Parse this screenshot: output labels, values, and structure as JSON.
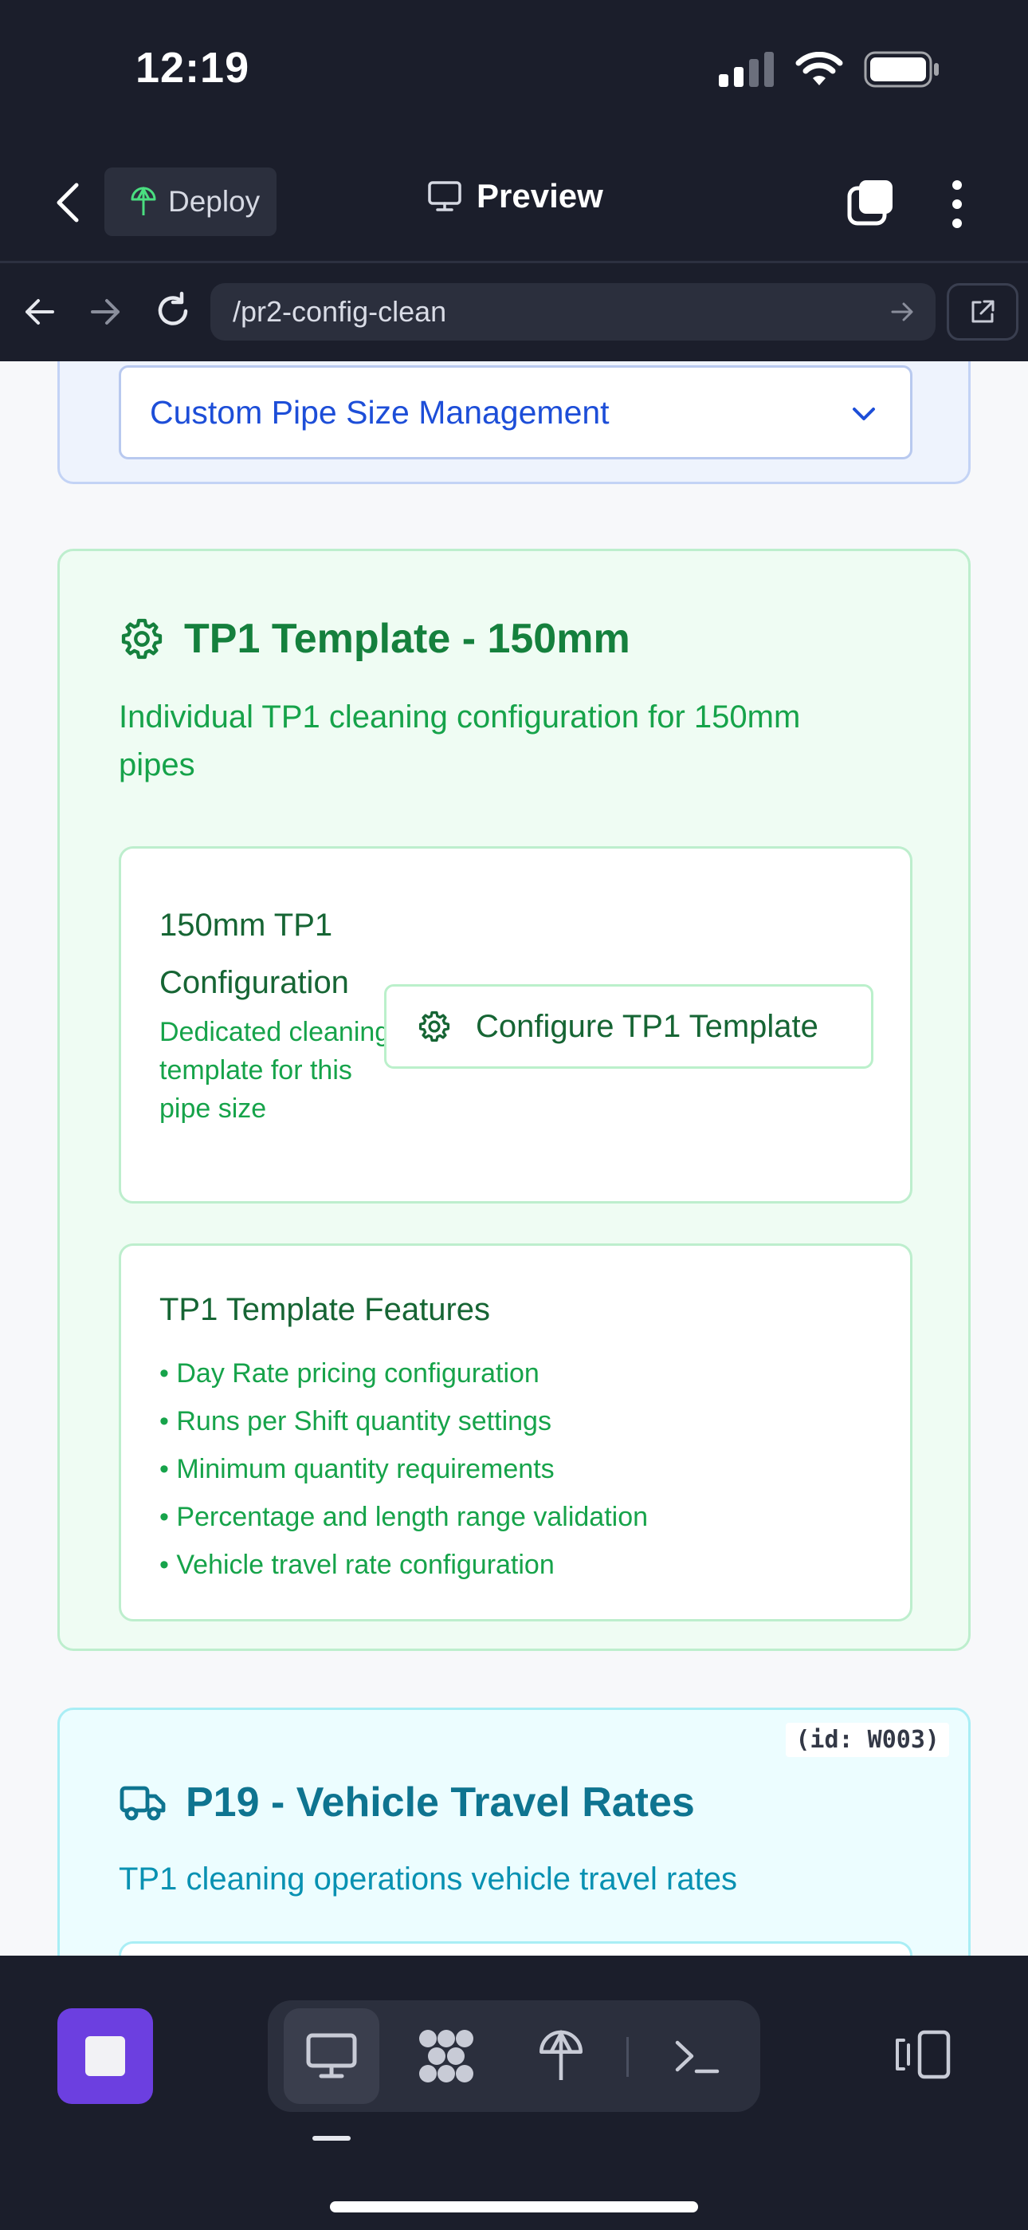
{
  "status_bar": {
    "time": "12:19"
  },
  "header": {
    "deploy_label": "Deploy",
    "preview_label": "Preview"
  },
  "url_bar": {
    "url": "/pr2-config-clean"
  },
  "pipe_size_section": {
    "select_value": "Custom Pipe Size Management"
  },
  "tp1_card": {
    "title": "TP1 Template - 150mm",
    "description": "Individual TP1 cleaning configuration for 150mm pipes",
    "config_title": "150mm TP1 Configuration",
    "config_subtitle": "Dedicated cleaning template for this pipe size",
    "config_button": "Configure TP1 Template",
    "features_title": "TP1 Template Features",
    "features": [
      "• Day Rate pricing configuration",
      "• Runs per Shift quantity settings",
      "• Minimum quantity requirements",
      "• Percentage and length range validation",
      "• Vehicle travel rate configuration"
    ]
  },
  "p19_card": {
    "id_tag": "(id: W003)",
    "title": "P19 - Vehicle Travel Rates",
    "description": "TP1 cleaning operations vehicle travel rates"
  },
  "icons": {
    "status": [
      "signal-icon",
      "wifi-icon",
      "battery-icon"
    ],
    "header": [
      "back-icon",
      "deploy-icon",
      "monitor-icon",
      "tabs-icon",
      "more-icon"
    ],
    "url_bar": [
      "nav-back-icon",
      "nav-forward-icon",
      "reload-icon",
      "go-icon",
      "open-external-icon"
    ],
    "toolbar": [
      "stop-icon",
      "monitor-icon",
      "agents-icon",
      "deploy-icon",
      "terminal-icon",
      "devices-icon"
    ]
  },
  "colors": {
    "dark_bg": "#1b1e2b",
    "green_accent": "#15803d",
    "cyan_accent": "#0e7490",
    "blue_accent": "#1d4ed8",
    "stop_button": "#6c3fe0"
  }
}
